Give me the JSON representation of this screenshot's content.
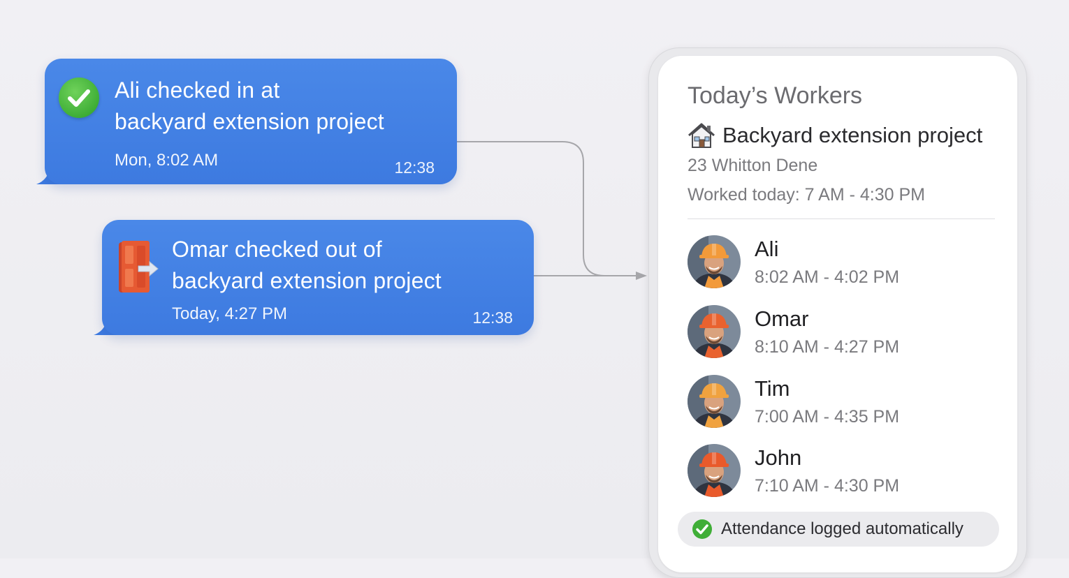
{
  "messages": [
    {
      "icon": "check-circle-icon",
      "line1": "Ali checked in at",
      "line2": "backyard extension project",
      "subtitle": "Mon, 8:02 AM",
      "time": "12:38"
    },
    {
      "icon": "door-exit-icon",
      "line1": "Omar checked out of",
      "line2": "backyard extension project",
      "subtitle": "Today, 4:27 PM",
      "time": "12:38"
    }
  ],
  "card": {
    "title": "Today’s Workers",
    "project_icon": "house-icon",
    "project_name": "Backyard extension project",
    "address": "23 Whitton Dene",
    "worked_today": "Worked today: 7 AM - 4:30 PM",
    "workers": [
      {
        "name": "Ali",
        "hours": "8:02 AM - 4:02 PM",
        "avatar": "worker-avatar-icon",
        "helmet_color": "#f29a3a"
      },
      {
        "name": "Omar",
        "hours": "8:10 AM - 4:27 PM",
        "avatar": "worker-avatar-icon",
        "helmet_color": "#e9622f"
      },
      {
        "name": "Tim",
        "hours": "7:00 AM - 4:35 PM",
        "avatar": "worker-avatar-icon",
        "helmet_color": "#f0a23f"
      },
      {
        "name": "John",
        "hours": "7:10 AM - 4:30 PM",
        "avatar": "worker-avatar-icon",
        "helmet_color": "#e95a2b"
      }
    ],
    "footer": "Attendance logged automatically"
  },
  "colors": {
    "bubble": "#3f7ee2",
    "check_green": "#3fae37",
    "door_orange": "#e2552f",
    "background": "#efeef2"
  }
}
